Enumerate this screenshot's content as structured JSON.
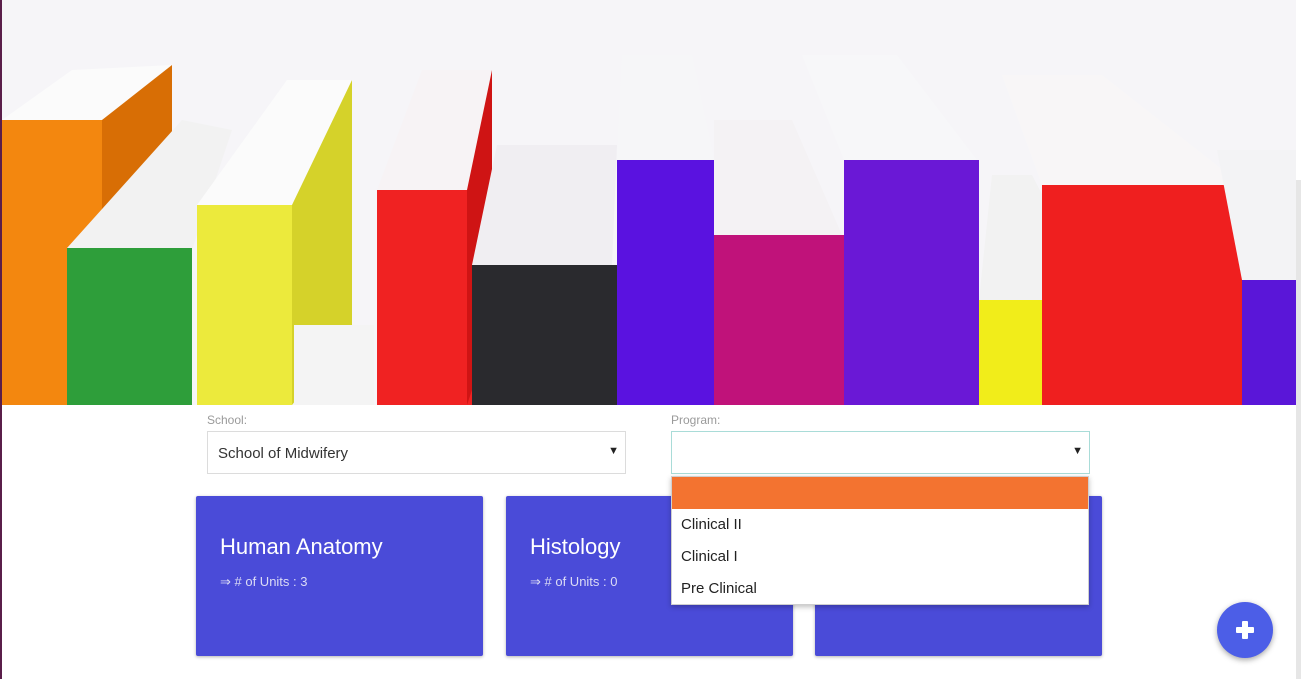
{
  "filters": {
    "school": {
      "label": "School:",
      "value": "School of Midwifery"
    },
    "program": {
      "label": "Program:",
      "value": "",
      "options": [
        "",
        "Clinical II",
        "Clinical I",
        "Pre Clinical"
      ]
    }
  },
  "cards": [
    {
      "title": "Human Anatomy",
      "units": "⇒ # of Units : 3"
    },
    {
      "title": "Histology",
      "units": "⇒ # of Units : 0"
    },
    {
      "title": "",
      "units": ""
    }
  ],
  "fab": {
    "icon": "plus-icon"
  },
  "colors": {
    "card": "#4a4bd8",
    "selected_option": "#f37330",
    "fab": "#4c5ee7"
  }
}
